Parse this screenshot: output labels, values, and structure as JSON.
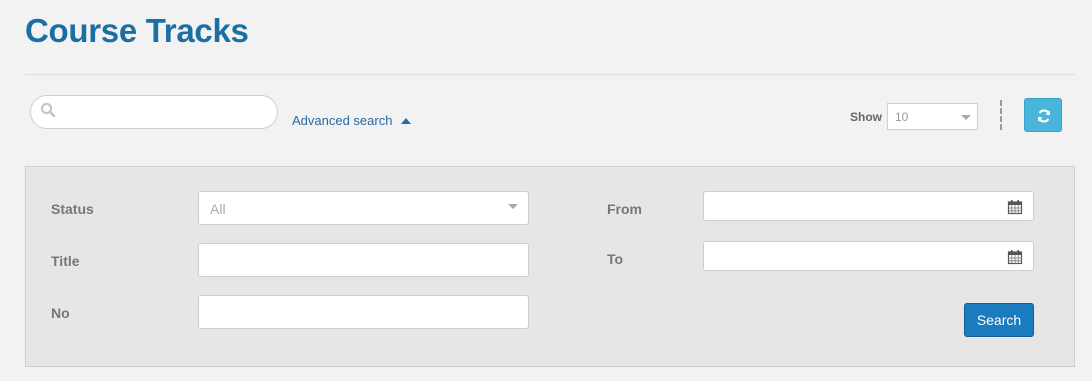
{
  "page": {
    "title": "Course Tracks"
  },
  "toolbar": {
    "search_placeholder": "",
    "search_value": "",
    "advanced_search_label": "Advanced search",
    "show_label": "Show",
    "show_value": "10",
    "accent_color": "#4ab5db"
  },
  "filters": {
    "status_label": "Status",
    "status_value": "All",
    "title_label": "Title",
    "title_value": "",
    "no_label": "No",
    "no_value": "",
    "from_label": "From",
    "from_value": "",
    "to_label": "To",
    "to_value": "",
    "search_button": "Search"
  },
  "icons": {
    "search": "search-icon",
    "advanced_toggle": "caret-up-icon",
    "select_arrow": "caret-down-icon",
    "refresh": "refresh-icon",
    "date_picker": "calendar-icon"
  }
}
